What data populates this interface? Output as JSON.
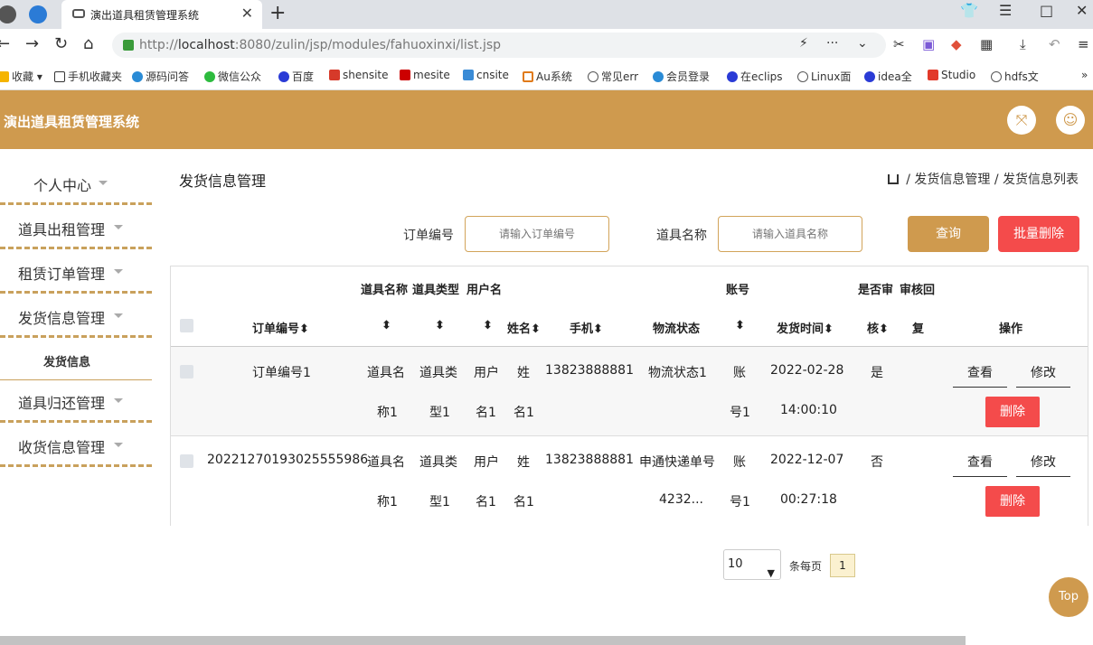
{
  "browser": {
    "tab_title": "演出道具租赁管理系统",
    "url_prefix": "http://",
    "url_host": "localhost",
    "url_path": ":8080/zulin/jsp/modules/fahuoxinxi/list.jsp",
    "bookmarks": [
      "收藏",
      "手机收藏夹",
      "源码问答",
      "微信公众",
      "百度",
      "shensite",
      "mesite",
      "cnsite",
      "Au系统",
      "常见err",
      "会员登录",
      "在eclips",
      "Linux面",
      "idea全",
      "Studio",
      "hdfs文"
    ]
  },
  "header": {
    "brand": "演出道具租赁管理系统"
  },
  "sidebar": {
    "items": [
      {
        "label": "个人中心"
      },
      {
        "label": "道具出租管理"
      },
      {
        "label": "租赁订单管理"
      },
      {
        "label": "发货信息管理"
      },
      {
        "label": "道具归还管理"
      },
      {
        "label": "收货信息管理"
      }
    ],
    "sub_item": "发货信息"
  },
  "main": {
    "title": "发货信息管理",
    "breadcrumb": [
      "发货信息管理",
      "发货信息列表"
    ],
    "search": {
      "order_label": "订单编号",
      "order_placeholder": "请输入订单编号",
      "prop_label": "道具名称",
      "prop_placeholder": "请输入道具名称",
      "query_btn": "查询",
      "batch_delete_btn": "批量删除"
    },
    "table": {
      "top_headers": {
        "a": "道具名称",
        "b": "道具类型",
        "c": "用户名",
        "d": "账号",
        "e": "是否审",
        "f": "审核回"
      },
      "headers": {
        "order": "订单编号",
        "name": "姓名",
        "phone": "手机",
        "logistics": "物流状态",
        "time": "发货时间",
        "audit": "核",
        "reply": "复",
        "op": "操作"
      },
      "rows": [
        {
          "order": "订单编号1",
          "prop1": "道具名",
          "prop2": "称1",
          "type1": "道具类",
          "type2": "型1",
          "user1": "用户",
          "user2": "名1",
          "name1": "姓",
          "name2": "名1",
          "phone": "13823888881",
          "logistics1": "物流状态1",
          "logistics2": "",
          "acct1": "账",
          "acct2": "号1",
          "date": "2022-02-28",
          "time": "14:00:10",
          "audit": "是"
        },
        {
          "order": "20221270193025555986",
          "prop1": "道具名",
          "prop2": "称1",
          "type1": "道具类",
          "type2": "型1",
          "user1": "用户",
          "user2": "名1",
          "name1": "姓",
          "name2": "名1",
          "phone": "13823888881",
          "logistics1": "申通快递单号",
          "logistics2": "4232...",
          "acct1": "账",
          "acct2": "号1",
          "date": "2022-12-07",
          "time": "00:27:18",
          "audit": "否"
        }
      ],
      "ops": {
        "view": "查看",
        "edit": "修改",
        "delete": "删除"
      }
    },
    "pager": {
      "page_size": "10",
      "per_page_label": "条每页",
      "current_page": "1"
    }
  },
  "top_button": "Top"
}
